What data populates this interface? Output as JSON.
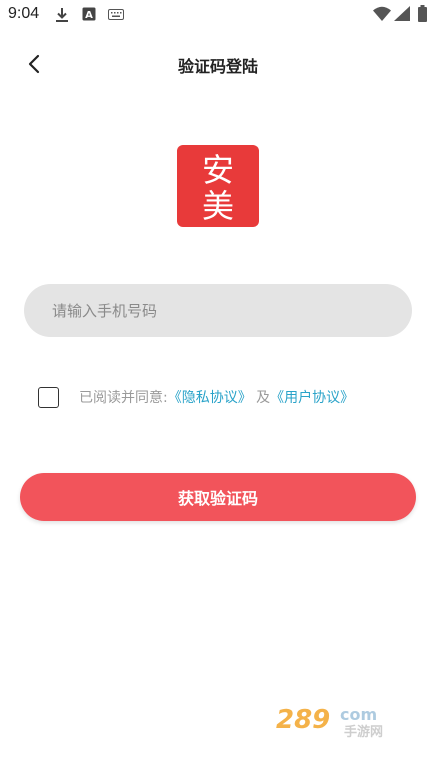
{
  "status_bar": {
    "time": "9:04",
    "left_icons": [
      "download-icon",
      "text-a-icon",
      "keyboard-icon"
    ],
    "right_icons": [
      "wifi-icon",
      "signal-icon",
      "battery-icon"
    ]
  },
  "header": {
    "back_icon": "chevron-left-icon",
    "title": "验证码登陆"
  },
  "logo": {
    "text_top": "安",
    "text_bottom": "美",
    "color": "#e83a3a"
  },
  "phone_field": {
    "placeholder": "请输入手机号码",
    "value": ""
  },
  "agreement": {
    "prefix": "已阅读并同意:",
    "privacy_link": "《隐私协议》",
    "joiner": "及",
    "user_link": "《用户协议》",
    "checked": false,
    "link_color": "#2aa3c9"
  },
  "submit": {
    "label": "获取验证码",
    "color": "#f2545b"
  },
  "watermark": {
    "text_main": "289",
    "text_com": "com",
    "text_sub": "手游网"
  }
}
